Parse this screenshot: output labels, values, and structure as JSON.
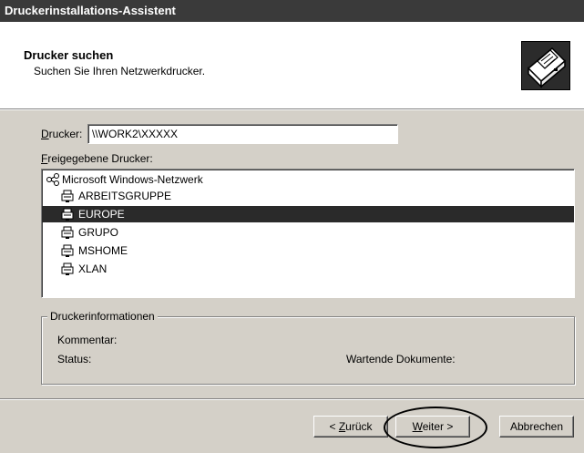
{
  "window": {
    "title": "Druckerinstallations-Assistent"
  },
  "header": {
    "title": "Drucker suchen",
    "subtitle": "Suchen Sie Ihren Netzwerkdrucker.",
    "icon": "printer-icon"
  },
  "printer_field": {
    "label_accel": "D",
    "label_rest": "rucker:",
    "value": "\\\\WORK2\\XXXXX"
  },
  "shared_printers": {
    "label_accel": "F",
    "label_rest": "reigegebene Drucker:",
    "root": {
      "label": "Microsoft Windows-Netzwerk",
      "icon": "network-icon"
    },
    "items": [
      {
        "label": "ARBEITSGRUPPE",
        "icon": "workgroup-icon",
        "selected": false
      },
      {
        "label": "EUROPE",
        "icon": "workgroup-icon",
        "selected": true
      },
      {
        "label": "GRUPO",
        "icon": "workgroup-icon",
        "selected": false
      },
      {
        "label": "MSHOME",
        "icon": "workgroup-icon",
        "selected": false
      },
      {
        "label": "XLAN",
        "icon": "workgroup-icon",
        "selected": false
      }
    ]
  },
  "printer_info": {
    "legend": "Druckerinformationen",
    "comment_label": "Kommentar:",
    "status_label": "Status:",
    "waiting_docs_label": "Wartende Dokumente:"
  },
  "buttons": {
    "back_prefix": "< ",
    "back_accel": "Z",
    "back_rest": "urück",
    "next_accel": "W",
    "next_rest": "eiter >",
    "cancel": "Abbrechen"
  },
  "colors": {
    "title_bar": "#3a3a3a",
    "selection": "#2a2a2a",
    "dialog_bg": "#d4d0c8"
  }
}
